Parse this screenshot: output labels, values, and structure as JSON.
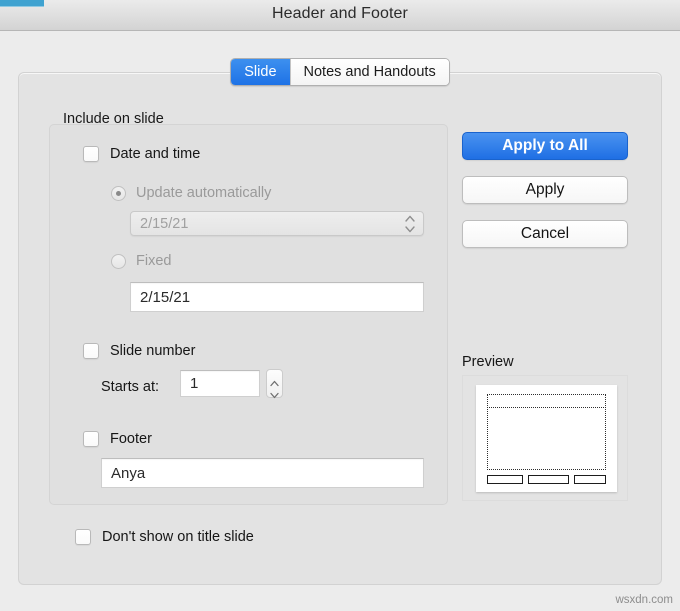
{
  "window": {
    "title": "Header and Footer",
    "accent_color": "#3fa2d0"
  },
  "tabs": [
    {
      "label": "Slide",
      "active": true
    },
    {
      "label": "Notes and Handouts",
      "active": false
    }
  ],
  "main": {
    "section_label": "Include on slide",
    "date_and_time": {
      "checkbox_label": "Date and time",
      "checked": false,
      "update_automatically": {
        "label": "Update automatically",
        "selected": true,
        "enabled": false,
        "value": "2/15/21"
      },
      "fixed": {
        "label": "Fixed",
        "selected": false,
        "enabled": false,
        "value": "2/15/21"
      }
    },
    "slide_number": {
      "checkbox_label": "Slide number",
      "checked": false,
      "starts_at_label": "Starts at:",
      "starts_at_value": "1"
    },
    "footer": {
      "checkbox_label": "Footer",
      "checked": false,
      "value": "Anya"
    },
    "dont_show_on_title_slide": {
      "checkbox_label": "Don't show on title slide",
      "checked": false
    }
  },
  "buttons": {
    "apply_to_all": "Apply to All",
    "apply": "Apply",
    "cancel": "Cancel",
    "primary_color": "#1f6fe4"
  },
  "preview": {
    "label": "Preview"
  },
  "watermark": {
    "text": "wsxdn.com"
  }
}
